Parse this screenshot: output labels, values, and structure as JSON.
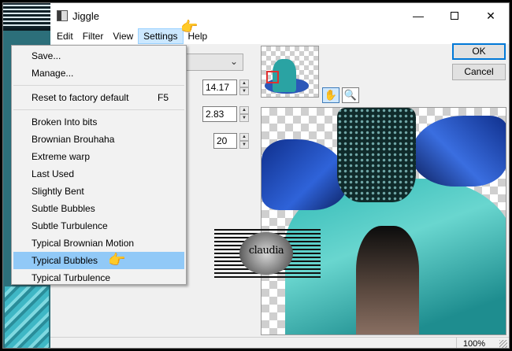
{
  "window": {
    "title": "Jiggle",
    "controls": {
      "minimize": "—",
      "maximize": "",
      "close": "✕"
    }
  },
  "menubar": {
    "items": [
      "Edit",
      "Filter",
      "View",
      "Settings",
      "Help"
    ],
    "active": "Settings"
  },
  "settings_menu": {
    "top_items": [
      "Save...",
      "Manage..."
    ],
    "reset": {
      "label": "Reset to factory default",
      "shortcut": "F5"
    },
    "presets": [
      "Broken Into bits",
      "Brownian Brouhaha",
      "Extreme warp",
      "Last Used",
      "Slightly Bent",
      "Subtle Bubbles",
      "Subtle Turbulence",
      "Typical Brownian Motion",
      "Typical Bubbles",
      "Typical Turbulence"
    ],
    "highlighted": "Typical Bubbles"
  },
  "controls": {
    "combo_value": "",
    "spin1": "14.17",
    "spin2": "2.83",
    "spin3": "20"
  },
  "tools": {
    "hand": "hand-tool",
    "zoom": "zoom-tool"
  },
  "buttons": {
    "ok": "OK",
    "cancel": "Cancel"
  },
  "watermark": {
    "text": "claudia"
  },
  "status": {
    "zoom": "100%"
  },
  "icons": {
    "hand": "✋",
    "zoom": "🔍",
    "pointer": "👉"
  },
  "colors": {
    "highlight": "#91c9f7",
    "active_menu": "#cce8ff",
    "default_button_border": "#0078d7"
  }
}
